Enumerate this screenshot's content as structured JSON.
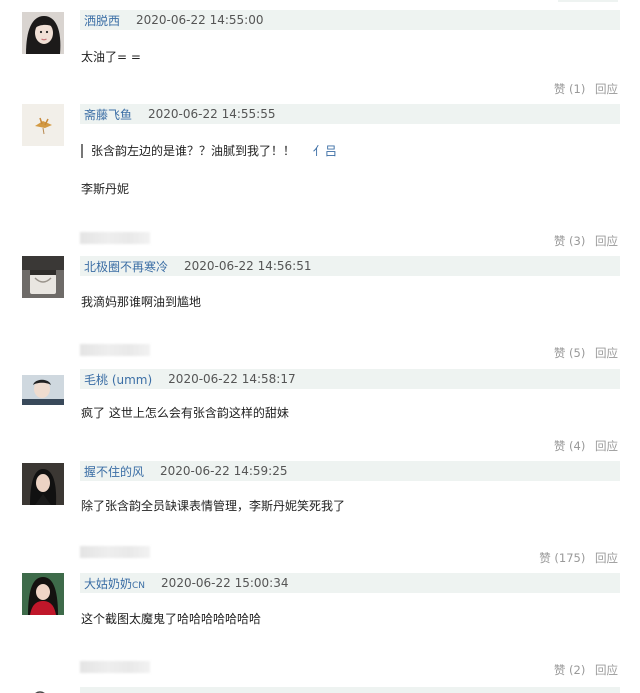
{
  "comments": [
    {
      "username": "洒脱西",
      "time": "2020-06-22 14:55:00",
      "text": "太油了= =",
      "like": "赞 (1)",
      "reply": "回应"
    },
    {
      "username": "斋藤飞鱼",
      "time": "2020-06-22 14:55:55",
      "quote": "张含韵左边的是谁？？油腻到我了！！",
      "quote_reply": "亻吕",
      "text": "李斯丹妮",
      "like": "赞 (3)",
      "reply": "回应"
    },
    {
      "username": "北极圈不再寒冷",
      "time": "2020-06-22 14:56:51",
      "text": "我滴妈那谁啊油到尴地",
      "like": "赞 (5)",
      "reply": "回应"
    },
    {
      "username": "毛桃 (umm)",
      "time": "2020-06-22 14:58:17",
      "text": "疯了 这世上怎么会有张含韵这样的甜妹",
      "like": "赞 (4)",
      "reply": "回应"
    },
    {
      "username": "握不住的风",
      "time": "2020-06-22 14:59:25",
      "text": "除了张含韵全员缺课表情管理，李斯丹妮笑死我了",
      "like": "赞 (175)",
      "reply": "回应"
    },
    {
      "username": "大姑奶奶",
      "username_suffix": "CN",
      "time": "2020-06-22 15:00:34",
      "text": "这个截图太魔鬼了哈哈哈哈哈哈哈",
      "like": "赞 (2)",
      "reply": "回应"
    }
  ],
  "colors": {
    "username": "#3b6ea5",
    "header_bg": "#eef3f1",
    "action": "#999999"
  }
}
